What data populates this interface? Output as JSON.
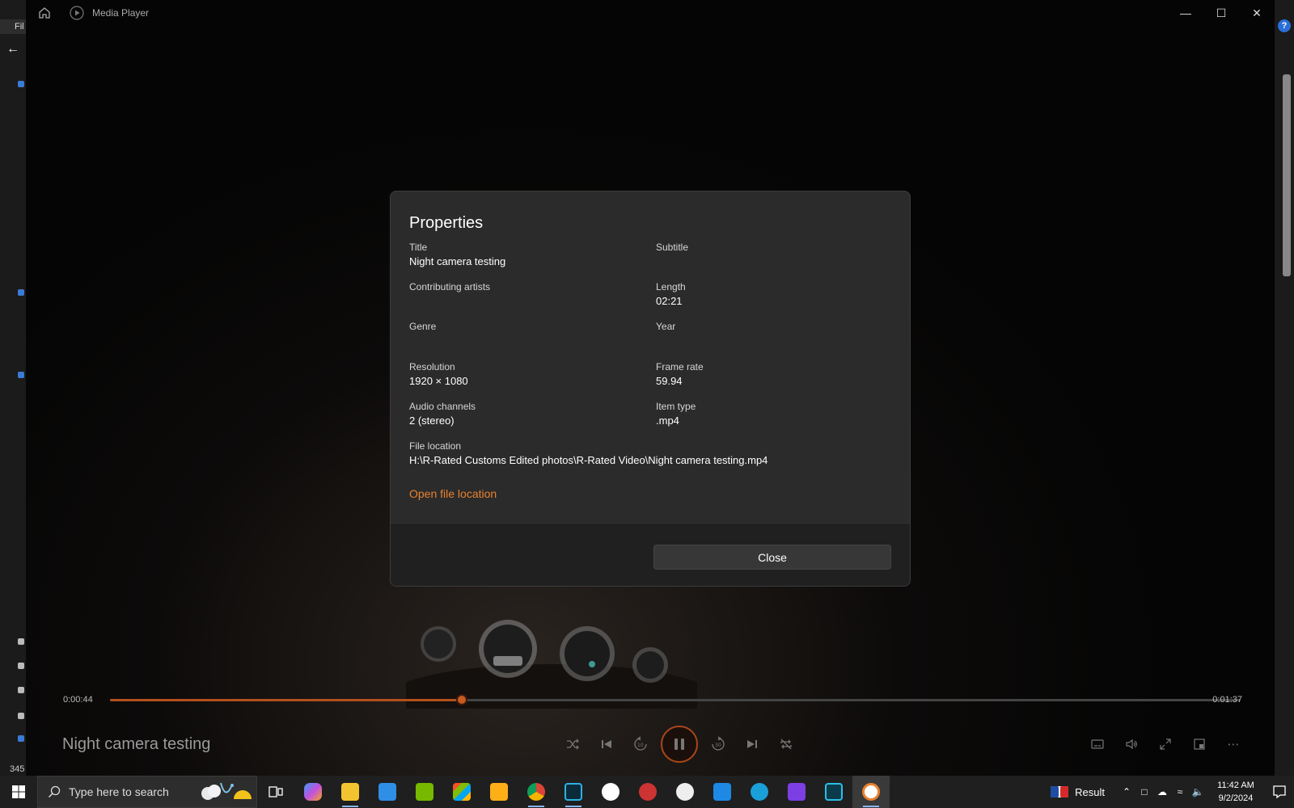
{
  "background": {
    "file_tab": "Fil",
    "count_text": "345"
  },
  "app": {
    "title": "Media Player"
  },
  "dialog": {
    "title": "Properties",
    "properties": [
      {
        "label": "Title",
        "value": "Night camera testing"
      },
      {
        "label": "Subtitle",
        "value": ""
      },
      {
        "label": "Contributing artists",
        "value": ""
      },
      {
        "label": "Length",
        "value": "02:21"
      },
      {
        "label": "Genre",
        "value": ""
      },
      {
        "label": "Year",
        "value": ""
      },
      {
        "label": "Resolution",
        "value": "1920 × 1080"
      },
      {
        "label": "Frame rate",
        "value": "59.94"
      },
      {
        "label": "Audio channels",
        "value": "2 (stereo)"
      },
      {
        "label": "Item type",
        "value": ".mp4"
      },
      {
        "label": "File location",
        "value": "H:\\R-Rated Customs Edited photos\\R-Rated Video\\Night camera testing.mp4"
      }
    ],
    "open_file_location": "Open file location",
    "close_label": "Close"
  },
  "playback": {
    "current_time": "0:00:44",
    "remaining_time": "0:01:37",
    "progress": 0.311,
    "now_playing_title": "Night camera testing"
  },
  "taskbar": {
    "search_placeholder": "Type here to search",
    "apps": [
      "task-view",
      "copilot",
      "file-explorer",
      "mail",
      "nvidia",
      "microsoft-store",
      "rockstar",
      "chrome",
      "kinemaster",
      "app-9",
      "app-10",
      "app-11",
      "app-12",
      "app-13",
      "app-14",
      "app-15",
      "media-player"
    ],
    "tray_result": "Result",
    "clock_time": "11:42 AM",
    "clock_date": "9/2/2024"
  },
  "colors": {
    "accent": "#e9822f",
    "seek_fill": "#b4501c",
    "dialog_bg": "#2b2b2b",
    "dialog_footer": "#202020"
  }
}
